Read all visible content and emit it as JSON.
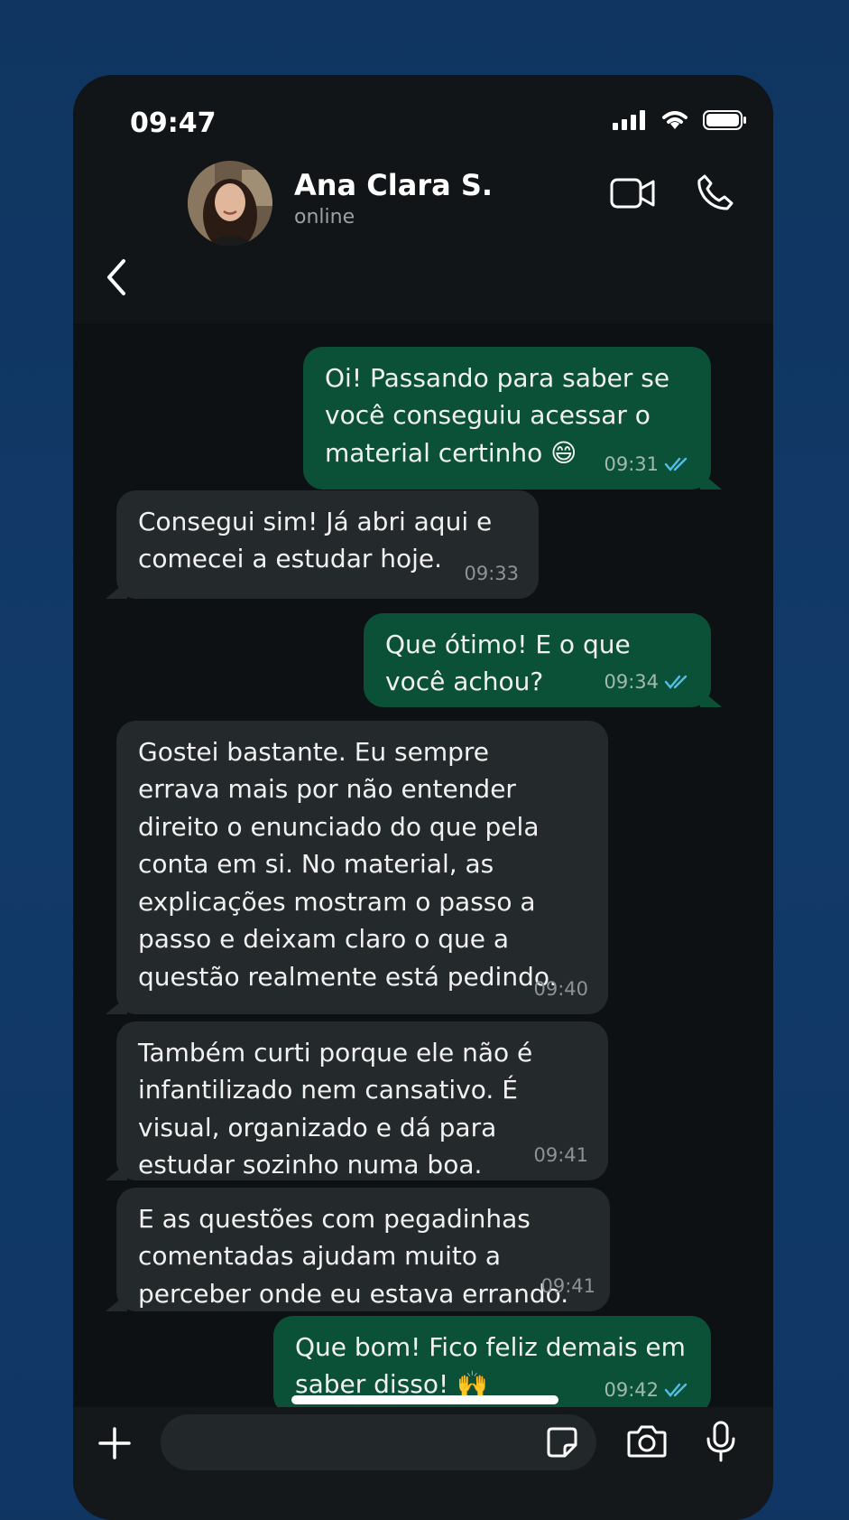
{
  "status": {
    "time": "09:47"
  },
  "contact": {
    "name": "Ana Clara S.",
    "presence": "online"
  },
  "messages": [
    {
      "dir": "out",
      "text": "Oi! Passando para saber se\nvocê conseguiu acessar o\nmaterial certinho 😄",
      "time": "09:31",
      "read": true
    },
    {
      "dir": "in",
      "text": "Consegui sim! Já abri aqui e\ncomecei a estudar hoje.",
      "time": "09:33"
    },
    {
      "dir": "out",
      "text": "Que ótimo! E o que\nvocê achou?",
      "time": "09:34",
      "read": true
    },
    {
      "dir": "in",
      "text": "Gostei bastante. Eu sempre\nerrava mais por não entender\ndireito o enunciado do que pela\nconta em si. No material, as\nexplicações mostram o passo a\npasso e deixam claro o que a\nquestão realmente está pedindo.",
      "time": "09:40"
    },
    {
      "dir": "in",
      "text": "Também curti porque ele não é\ninfantilizado nem cansativo. É\nvisual, organizado e dá para\nestudar sozinho numa boa.",
      "time": "09:41"
    },
    {
      "dir": "in",
      "text": "E as questões com pegadinhas\ncomentadas ajudam muito a\nperceber onde eu estava errando.",
      "time": "09:41"
    },
    {
      "dir": "out",
      "text": "Que bom! Fico feliz demais em\nsaber disso! 🙌",
      "time": "09:42",
      "read": true
    }
  ],
  "icons": {
    "back": "chevron-left-icon",
    "video": "video-camera-icon",
    "call": "phone-icon",
    "add": "plus-icon",
    "sticker": "sticker-icon",
    "camera": "camera-icon",
    "mic": "microphone-icon",
    "read": "double-check-icon"
  },
  "colors": {
    "outgoing": "#0b5138",
    "incoming": "#24292c",
    "read_check": "#53bdeb",
    "background": "#123a69"
  }
}
